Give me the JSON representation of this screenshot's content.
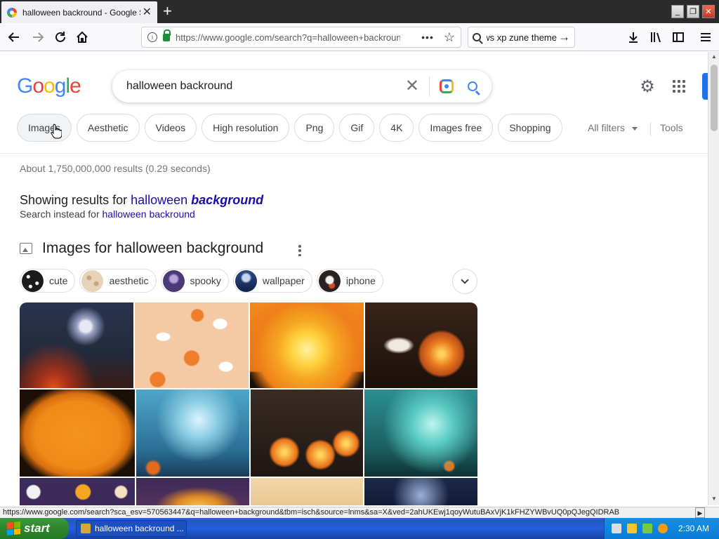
{
  "browser": {
    "tab_title": "halloween backround - Google Search",
    "tab_close": "✕",
    "new_tab": "+",
    "url": "https://www.google.com/search?q=halloween+backround",
    "search_value": "windows xp zune theme",
    "win_min": "_",
    "win_max": "❐",
    "win_close": "✕"
  },
  "google": {
    "query": "halloween backround",
    "chips": [
      {
        "label": "Images"
      },
      {
        "label": "Aesthetic"
      },
      {
        "label": "Videos"
      },
      {
        "label": "High resolution"
      },
      {
        "label": "Png"
      },
      {
        "label": "Gif"
      },
      {
        "label": "4K"
      },
      {
        "label": "Images free"
      },
      {
        "label": "Shopping"
      }
    ],
    "all_filters": "All filters",
    "tools": "Tools",
    "stats": "About 1,750,000,000 results (0.29 seconds)",
    "showing_prefix": "Showing results for",
    "showing_plain": "halloween",
    "showing_corrected": "background",
    "instead_prefix": "Search instead for",
    "instead_link": "halloween backround",
    "images_heading": "Images for halloween background",
    "refine": [
      {
        "label": "cute",
        "color": "#1b1b1b"
      },
      {
        "label": "aesthetic",
        "color": "#e9d3b8"
      },
      {
        "label": "spooky",
        "color": "#4b3a75"
      },
      {
        "label": "wallpaper",
        "color": "#2f4b8a"
      },
      {
        "label": "iphone",
        "color": "#2a2220"
      }
    ]
  },
  "status_url": "https://www.google.com/search?sca_esv=570563447&q=halloween+background&tbm=isch&source=lnms&sa=X&ved=2ahUKEwj1qoyWutuBAxVjK1kFHZYWBvUQ0pQJegQIDRAB",
  "taskbar": {
    "start": "start",
    "task_label": "halloween backround ...",
    "clock": "2:30 AM"
  }
}
